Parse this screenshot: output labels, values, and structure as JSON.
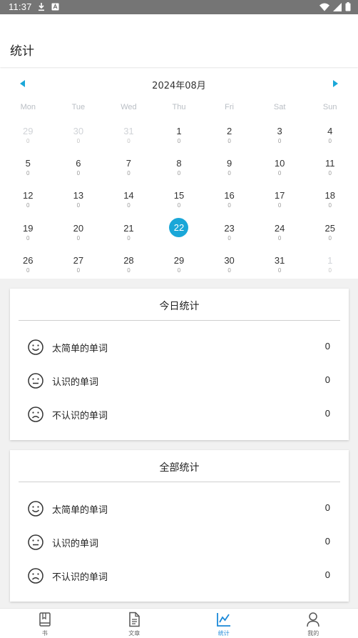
{
  "status_bar": {
    "time": "11:37",
    "icons": [
      "download-icon",
      "text-recognition-icon",
      "wifi-icon",
      "signal-icon",
      "battery-icon"
    ]
  },
  "header": {
    "title": "统计"
  },
  "calendar": {
    "month_label": "2024年08月",
    "weekdays": [
      "Mon",
      "Tue",
      "Wed",
      "Thu",
      "Fri",
      "Sat",
      "Sun"
    ],
    "selected_day": 22,
    "accent_color": "#1aa7d8",
    "days": [
      {
        "day": "29",
        "count": "0",
        "current_month": false
      },
      {
        "day": "30",
        "count": "0",
        "current_month": false
      },
      {
        "day": "31",
        "count": "0",
        "current_month": false
      },
      {
        "day": "1",
        "count": "0",
        "current_month": true
      },
      {
        "day": "2",
        "count": "0",
        "current_month": true
      },
      {
        "day": "3",
        "count": "0",
        "current_month": true
      },
      {
        "day": "4",
        "count": "0",
        "current_month": true
      },
      {
        "day": "5",
        "count": "0",
        "current_month": true
      },
      {
        "day": "6",
        "count": "0",
        "current_month": true
      },
      {
        "day": "7",
        "count": "0",
        "current_month": true
      },
      {
        "day": "8",
        "count": "0",
        "current_month": true
      },
      {
        "day": "9",
        "count": "0",
        "current_month": true
      },
      {
        "day": "10",
        "count": "0",
        "current_month": true
      },
      {
        "day": "11",
        "count": "0",
        "current_month": true
      },
      {
        "day": "12",
        "count": "0",
        "current_month": true
      },
      {
        "day": "13",
        "count": "0",
        "current_month": true
      },
      {
        "day": "14",
        "count": "0",
        "current_month": true
      },
      {
        "day": "15",
        "count": "0",
        "current_month": true
      },
      {
        "day": "16",
        "count": "0",
        "current_month": true
      },
      {
        "day": "17",
        "count": "0",
        "current_month": true
      },
      {
        "day": "18",
        "count": "0",
        "current_month": true
      },
      {
        "day": "19",
        "count": "0",
        "current_month": true
      },
      {
        "day": "20",
        "count": "0",
        "current_month": true
      },
      {
        "day": "21",
        "count": "0",
        "current_month": true
      },
      {
        "day": "22",
        "count": "",
        "current_month": true
      },
      {
        "day": "23",
        "count": "0",
        "current_month": true
      },
      {
        "day": "24",
        "count": "0",
        "current_month": true
      },
      {
        "day": "25",
        "count": "0",
        "current_month": true
      },
      {
        "day": "26",
        "count": "0",
        "current_month": true
      },
      {
        "day": "27",
        "count": "0",
        "current_month": true
      },
      {
        "day": "28",
        "count": "0",
        "current_month": true
      },
      {
        "day": "29",
        "count": "0",
        "current_month": true
      },
      {
        "day": "30",
        "count": "0",
        "current_month": true
      },
      {
        "day": "31",
        "count": "0",
        "current_month": true
      },
      {
        "day": "1",
        "count": "0",
        "current_month": false
      }
    ]
  },
  "today_stats": {
    "title": "今日统计",
    "rows": [
      {
        "icon": "smile-face-icon",
        "label": "太简单的单词",
        "value": "0"
      },
      {
        "icon": "neutral-face-icon",
        "label": "认识的单词",
        "value": "0"
      },
      {
        "icon": "sad-face-icon",
        "label": "不认识的单词",
        "value": "0"
      }
    ]
  },
  "all_stats": {
    "title": "全部统计",
    "rows": [
      {
        "icon": "smile-face-icon",
        "label": "太简单的单词",
        "value": "0"
      },
      {
        "icon": "neutral-face-icon",
        "label": "认识的单词",
        "value": "0"
      },
      {
        "icon": "sad-face-icon",
        "label": "不认识的单词",
        "value": "0"
      }
    ]
  },
  "bottom_nav": {
    "active_color": "#1a88d8",
    "items": [
      {
        "label": "书",
        "icon": "book-icon",
        "active": false
      },
      {
        "label": "文章",
        "icon": "document-icon",
        "active": false
      },
      {
        "label": "统计",
        "icon": "chart-icon",
        "active": true
      },
      {
        "label": "我的",
        "icon": "person-icon",
        "active": false
      }
    ]
  }
}
